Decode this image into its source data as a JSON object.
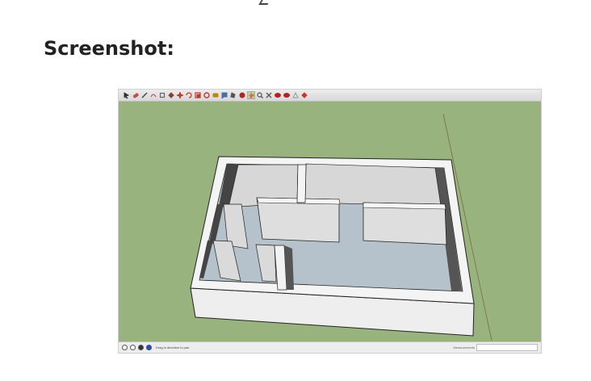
{
  "heading": "Screenshot:",
  "app": {
    "toolbar": {
      "tools": [
        {
          "name": "select-tool-icon",
          "color": "#333333"
        },
        {
          "name": "eraser-tool-icon",
          "color": "#c0504d"
        },
        {
          "name": "line-tool-icon",
          "color": "#444444"
        },
        {
          "name": "arc-tool-icon",
          "color": "#c0504d"
        },
        {
          "name": "rectangle-tool-icon",
          "color": "#666666"
        },
        {
          "name": "push-pull-tool-icon",
          "color": "#8b3a3a"
        },
        {
          "name": "move-tool-icon",
          "color": "#c0392b"
        },
        {
          "name": "rotate-tool-icon",
          "color": "#c0392b"
        },
        {
          "name": "scale-tool-icon",
          "color": "#c0392b"
        },
        {
          "name": "offset-tool-icon",
          "color": "#c0392b"
        },
        {
          "name": "tape-measure-tool-icon",
          "color": "#b8860b"
        },
        {
          "name": "text-tool-icon",
          "color": "#4a6fa5"
        },
        {
          "name": "paint-bucket-tool-icon",
          "color": "#555555"
        },
        {
          "name": "orbit-tool-icon",
          "color": "#b22222"
        },
        {
          "name": "pan-tool-icon",
          "color": "#b8860b",
          "active": true
        },
        {
          "name": "zoom-tool-icon",
          "color": "#555555"
        },
        {
          "name": "zoom-extents-tool-icon",
          "color": "#555555"
        },
        {
          "name": "warehouse-tool-icon",
          "color": "#b22222"
        },
        {
          "name": "extension-warehouse-tool-icon",
          "color": "#b22222"
        },
        {
          "name": "layout-tool-icon",
          "color": "#999999"
        },
        {
          "name": "ruby-tool-icon",
          "color": "#c0392b"
        }
      ]
    },
    "statusbar": {
      "text": "Drag in direction to pan",
      "measurements_label": "Measurements",
      "measurements_value": ""
    }
  }
}
